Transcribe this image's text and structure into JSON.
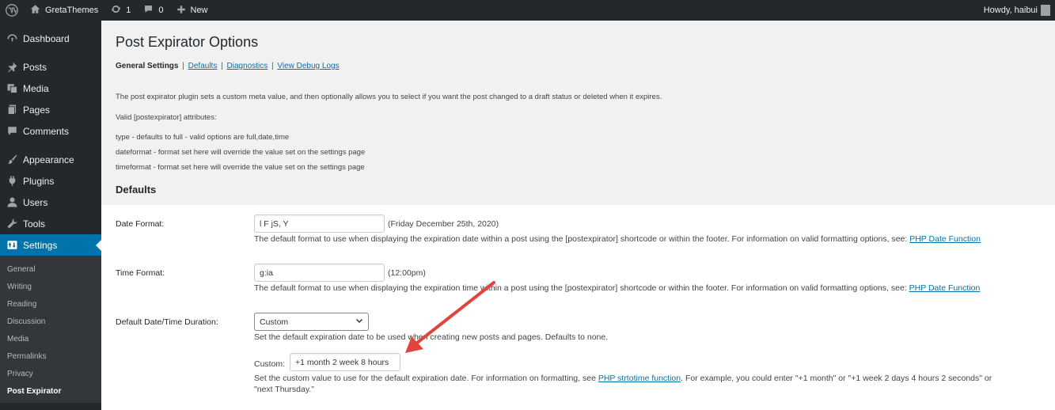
{
  "adminbar": {
    "site_name": "GretaThemes",
    "updates_count": "1",
    "comments_count": "0",
    "new_label": "New",
    "howdy": "Howdy, haibui"
  },
  "sidebar": {
    "items": [
      {
        "label": "Dashboard",
        "icon": "dashboard-icon"
      },
      {
        "label": "Posts",
        "icon": "pin-icon"
      },
      {
        "label": "Media",
        "icon": "media-icon"
      },
      {
        "label": "Pages",
        "icon": "pages-icon"
      },
      {
        "label": "Comments",
        "icon": "comment-icon"
      },
      {
        "label": "Appearance",
        "icon": "paintbrush-icon"
      },
      {
        "label": "Plugins",
        "icon": "plugin-icon"
      },
      {
        "label": "Users",
        "icon": "users-icon"
      },
      {
        "label": "Tools",
        "icon": "wrench-icon"
      },
      {
        "label": "Settings",
        "icon": "settings-icon"
      }
    ],
    "submenu": [
      "General",
      "Writing",
      "Reading",
      "Discussion",
      "Media",
      "Permalinks",
      "Privacy",
      "Post Expirator"
    ]
  },
  "page": {
    "title": "Post Expirator Options",
    "subnav": {
      "current": "General Settings",
      "links": [
        "Defaults",
        "Diagnostics",
        "View Debug Logs"
      ],
      "separator": "|"
    },
    "intro": "The post expirator plugin sets a custom meta value, and then optionally allows you to select if you want the post changed to a draft status or deleted when it expires.",
    "attributes_heading": "Valid [postexpirator] attributes:",
    "attributes": [
      "type - defaults to full - valid options are full,date,time",
      "dateformat - format set here will override the value set on the settings page",
      "timeformat - format set here will override the value set on the settings page"
    ],
    "defaults_heading": "Defaults",
    "date_format": {
      "label": "Date Format:",
      "value": "l F jS, Y",
      "sample": "(Friday December 25th, 2020)",
      "description": "The default format to use when displaying the expiration date within a post using the [postexpirator] shortcode or within the footer. For information on valid formatting options, see:",
      "link": "PHP Date Function"
    },
    "time_format": {
      "label": "Time Format:",
      "value": "g:ia",
      "sample": "(12:00pm)",
      "description": "The default format to use when displaying the expiration time within a post using the [postexpirator] shortcode or within the footer. For information on valid formatting options, see:",
      "link": "PHP Date Function"
    },
    "duration": {
      "label": "Default Date/Time Duration:",
      "selected": "Custom",
      "description": "Set the default expiration date to be used when creating new posts and pages. Defaults to none.",
      "custom_label": "Custom:",
      "custom_value": "+1 month 2 week 8 hours",
      "custom_desc_before": "Set the custom value to use for the default expiration date. For information on formatting, see",
      "custom_desc_link": "PHP strtotime function",
      "custom_desc_after": ". For example, you could enter \"+1 month\" or \"+1 week 2 days 4 hours 2 seconds\" or",
      "custom_desc_line2": "\"next Thursday.\""
    }
  },
  "colors": {
    "adminbar_bg": "#23282d",
    "sidebar_bg": "#23282d",
    "accent": "#0073aa",
    "annotation_arrow": "#e0443e"
  }
}
